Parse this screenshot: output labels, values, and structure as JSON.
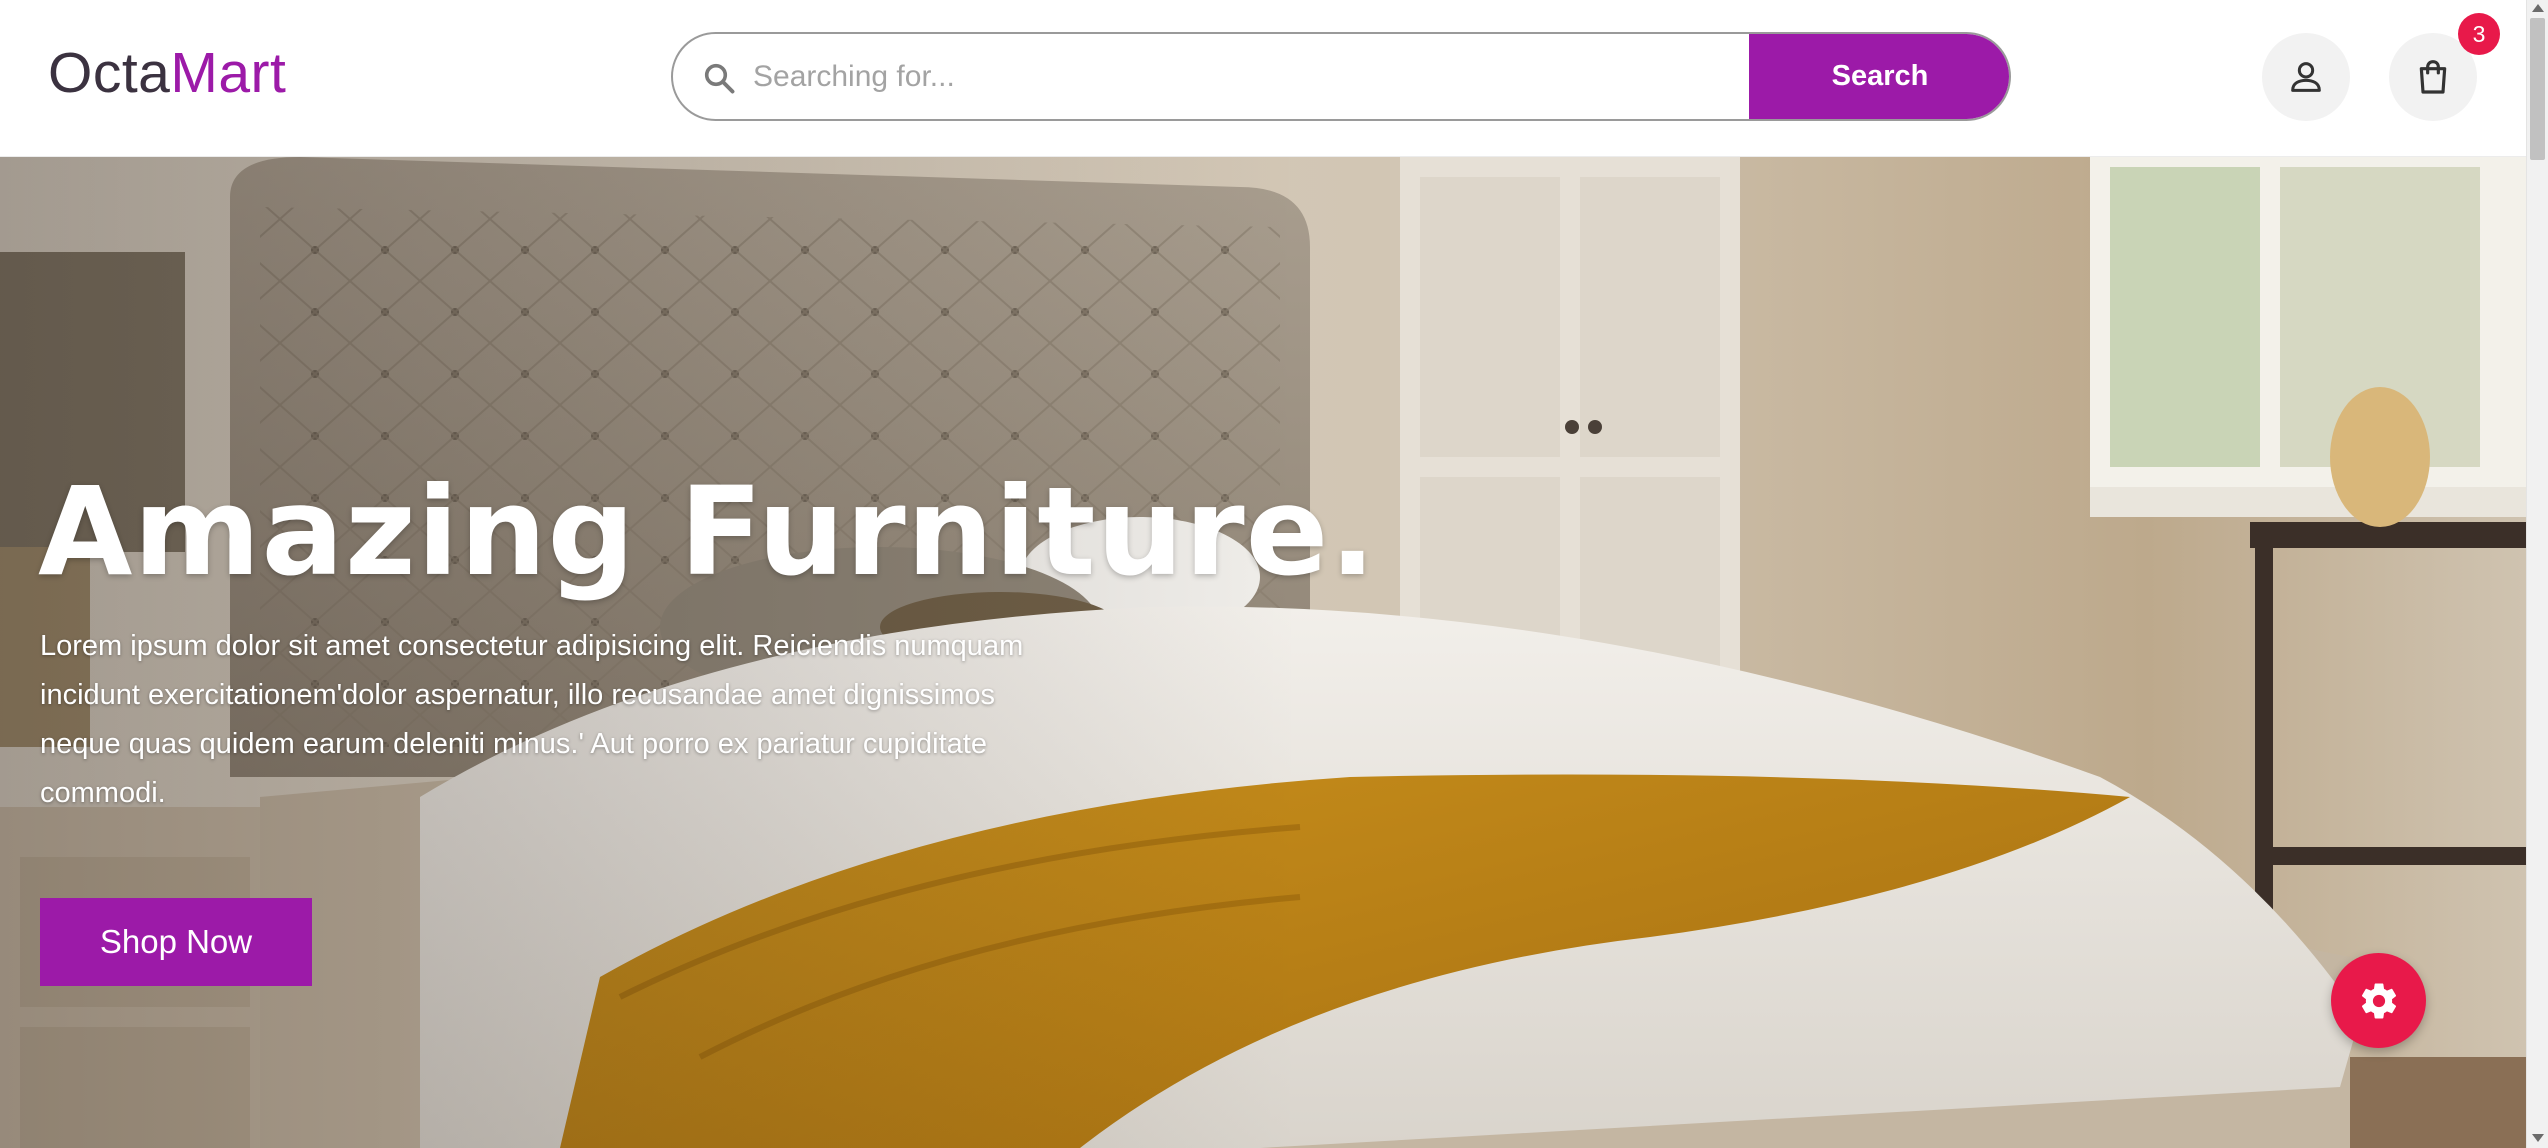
{
  "brand": {
    "logo_part1": "Octa",
    "logo_part2": "Mart"
  },
  "search": {
    "placeholder": "Searching for...",
    "button_label": "Search"
  },
  "header": {
    "cart_count": "3"
  },
  "hero": {
    "title": "Amazing Furniture.",
    "description": "Lorem ipsum dolor sit amet consectetur adipisicing elit. Reiciendis numquam incidunt exercitationem'dolor aspernatur, illo recusandae amet dignissimos neque quas quidem earum deleniti minus.' Aut porro ex pariatur cupiditate commodi.",
    "cta_label": "Shop Now",
    "image_subject": "bedroom with tufted headboard bed and mustard throw"
  },
  "icons": {
    "search": "search-icon",
    "user": "user-icon",
    "cart": "shopping-bag-icon",
    "settings": "gear-icon"
  },
  "colors": {
    "brand_purple": "#9c1aa8",
    "badge_red": "#e8194a",
    "logo_dark": "#3b3240"
  }
}
